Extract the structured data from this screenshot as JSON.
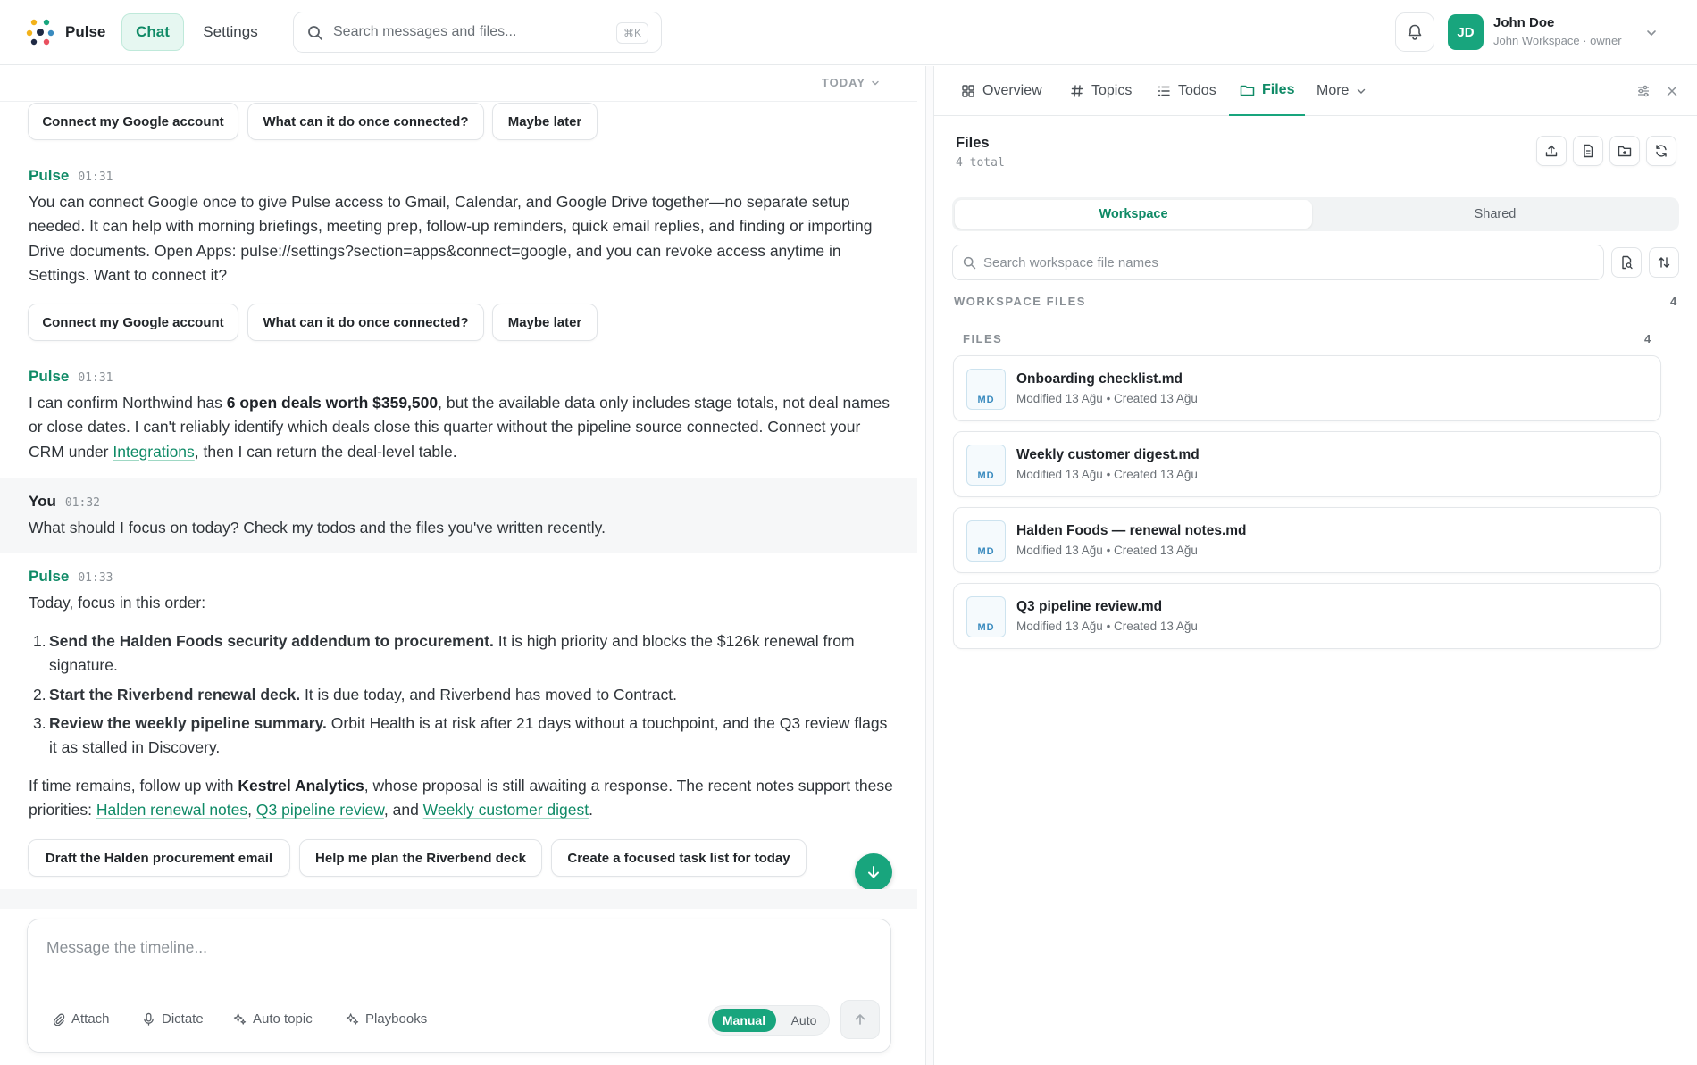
{
  "app": {
    "brand": "Pulse",
    "nav": {
      "chat": "Chat",
      "settings": "Settings"
    },
    "search": {
      "placeholder": "Search messages and files...",
      "shortcut": "⌘K"
    }
  },
  "user": {
    "initials": "JD",
    "name": "John Doe",
    "workspace": "John Workspace · owner"
  },
  "chat": {
    "date_divider": "TODAY",
    "chips_1": [
      "Connect my Google account",
      "What can it do once connected?",
      "Maybe later"
    ],
    "msg1": {
      "author": "Pulse",
      "time": "01:31",
      "text": "You can connect Google once to give Pulse access to Gmail, Calendar, and Google Drive together—no separate setup needed. It can help with morning briefings, meeting prep, follow-up reminders, quick email replies, and finding or importing Drive documents. Open Apps: pulse://settings?section=apps&connect=google, and you can revoke access anytime in Settings. Want to connect it?"
    },
    "chips_2": [
      "Connect my Google account",
      "What can it do once connected?",
      "Maybe later"
    ],
    "msg2": {
      "author": "Pulse",
      "time": "01:31",
      "t1": "I can confirm Northwind has ",
      "bold": "6 open deals worth $359,500",
      "t2": ", but the available data only includes stage totals, not deal names or close dates. I can't reliably identify which deals close this quarter without the pipeline source connected. Connect your CRM under ",
      "link": "Integrations",
      "t3": ", then I can return the deal-level table."
    },
    "msg3": {
      "author": "You",
      "time": "01:32",
      "text": "What should I focus on today? Check my todos and the files you've written recently."
    },
    "msg4": {
      "author": "Pulse",
      "time": "01:33",
      "intro": "Today, focus in this order:",
      "items": [
        {
          "num": "1.",
          "bold": "Send the Halden Foods security addendum to procurement.",
          "text": " It is high priority and blocks the $126k renewal from signature."
        },
        {
          "num": "2.",
          "bold": "Start the Riverbend renewal deck.",
          "text": " It is due today, and Riverbend has moved to Contract."
        },
        {
          "num": "3.",
          "bold": "Review the weekly pipeline summary.",
          "text": " Orbit Health is at risk after 21 days without a touchpoint, and the Q3 review flags it as stalled in Discovery."
        }
      ],
      "o1": "If time remains, follow up with ",
      "obold": "Kestrel Analytics",
      "o2": ", whose proposal is still awaiting a response. The recent notes support these priorities: ",
      "links": [
        "Halden renewal notes",
        "Q3 pipeline review",
        "Weekly customer digest"
      ],
      "sep1": ", ",
      "sep2": ", and ",
      "end": "."
    },
    "chips_3": [
      "Draft the Halden procurement email",
      "Help me plan the Riverbend deck",
      "Create a focused task list for today"
    ],
    "composer": {
      "placeholder": "Message the timeline...",
      "tools": [
        "Attach",
        "Dictate",
        "Auto topic",
        "Playbooks"
      ],
      "mode_manual": "Manual",
      "mode_auto": "Auto"
    }
  },
  "panel": {
    "tabs": [
      "Overview",
      "Topics",
      "Todos",
      "Files",
      "More"
    ],
    "active_tab": "Files",
    "title": "Files",
    "count": "4 total",
    "scope": {
      "workspace": "Workspace",
      "shared": "Shared"
    },
    "search_placeholder": "Search workspace file names",
    "section": {
      "label": "WORKSPACE FILES",
      "count": "4"
    },
    "group": {
      "label": "FILES",
      "count": "4"
    },
    "files": [
      {
        "type": "MD",
        "name": "Onboarding checklist.md",
        "meta": "Modified 13 Ağu • Created 13 Ağu"
      },
      {
        "type": "MD",
        "name": "Weekly customer digest.md",
        "meta": "Modified 13 Ağu • Created 13 Ağu"
      },
      {
        "type": "MD",
        "name": "Halden Foods — renewal notes.md",
        "meta": "Modified 13 Ağu • Created 13 Ağu"
      },
      {
        "type": "MD",
        "name": "Q3 pipeline review.md",
        "meta": "Modified 13 Ağu • Created 13 Ağu"
      }
    ]
  },
  "colors": {
    "accent": "#18a57d",
    "accent_text": "#0f8a66"
  }
}
